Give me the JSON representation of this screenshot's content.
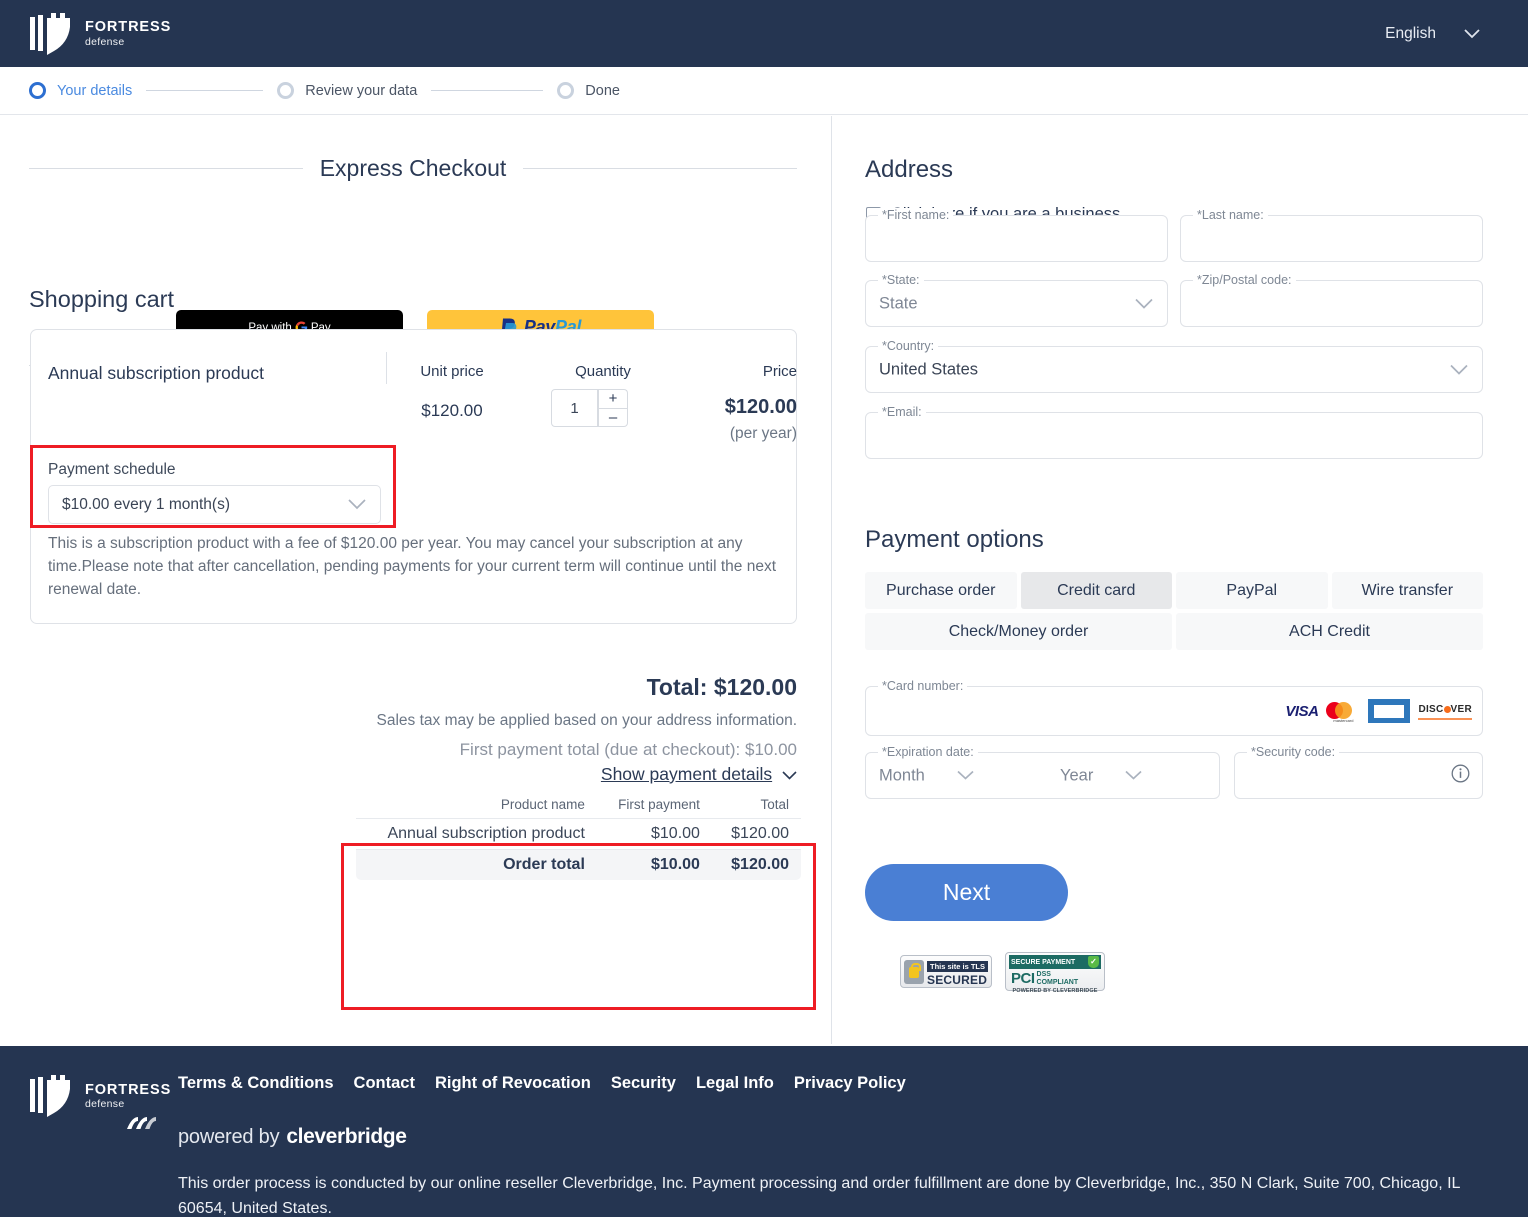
{
  "header": {
    "brand_title": "FORTRESS",
    "brand_sub": "defense",
    "language": "English"
  },
  "stepper": {
    "steps": [
      {
        "label": "Your details",
        "state": "active"
      },
      {
        "label": "Review your data",
        "state": "inactive"
      },
      {
        "label": "Done",
        "state": "inactive"
      }
    ]
  },
  "express": {
    "title": "Express Checkout",
    "gpay_label": "Pay with",
    "gpay_g": "G",
    "gpay_pay": "Pay",
    "paypal_p": "Pay",
    "paypal_pal": "Pal"
  },
  "cart": {
    "title": "Shopping cart",
    "product_name": "Annual subscription product",
    "col_unit_price": "Unit price",
    "col_quantity": "Quantity",
    "col_price": "Price",
    "unit_price": "$120.00",
    "quantity": "1",
    "increment": "+",
    "decrement": "–",
    "price": "$120.00",
    "price_period": "(per year)",
    "schedule_label": "Payment schedule",
    "schedule_value": "$10.00 every 1 month(s)",
    "subscription_note": "This is a subscription product with a fee of $120.00 per year. You may cancel your subscription at any time.Please note that after cancellation, pending payments for your current term will continue until the next renewal date."
  },
  "totals": {
    "total_line": "Total: $120.00",
    "tax_note": "Sales tax may be applied based on your address information.",
    "first_payment_line": "First payment total (due at checkout):  $10.00",
    "show_details": "Show payment details",
    "table": {
      "headers": [
        "Product name",
        "First payment",
        "Total"
      ],
      "rows": [
        {
          "name": "Annual subscription product",
          "first_payment": "$10.00",
          "total": "$120.00"
        }
      ],
      "order_total": {
        "name": "Order total",
        "first_payment": "$10.00",
        "total": "$120.00"
      }
    }
  },
  "address": {
    "title": "Address",
    "business_checkbox_label": "Click here if you are a business.",
    "fields": [
      {
        "label": "*First name:",
        "value": ""
      },
      {
        "label": "*Last name:",
        "value": ""
      },
      {
        "label": "*State:",
        "value": "State"
      },
      {
        "label": "*Zip/Postal code:",
        "value": ""
      },
      {
        "label": "*Country:",
        "value": "United States"
      },
      {
        "label": "*Email:",
        "value": ""
      }
    ]
  },
  "payment": {
    "title": "Payment options",
    "tabs_row1": [
      {
        "label": "Purchase order",
        "selected": false
      },
      {
        "label": "Credit card",
        "selected": true
      },
      {
        "label": "PayPal",
        "selected": false
      },
      {
        "label": "Wire transfer",
        "selected": false
      }
    ],
    "tabs_row2": [
      {
        "label": "Check/Money order",
        "selected": false
      },
      {
        "label": "ACH Credit",
        "selected": false
      }
    ],
    "card_number_label": "*Card number:",
    "card_number_value": "",
    "card_brands": [
      "VISA",
      "mastercard",
      "AMERICAN EXPRESS",
      "DISCOVER"
    ],
    "expiration_label": "*Expiration date:",
    "expiration_month": "Month",
    "expiration_year": "Year",
    "security_label": "*Security code:",
    "security_value": "",
    "next_button": "Next",
    "badges": {
      "tls_top": "This site is TLS",
      "tls_bottom": "SECURED",
      "pci_top": "SECURE PAYMENT",
      "pci_main": "PCI",
      "pci_dss": "DSS",
      "pci_compliant": "COMPLIANT",
      "pci_bottom": "POWERED BY CLEVERBRIDGE"
    }
  },
  "footer": {
    "brand_title": "FORTRESS",
    "brand_sub": "defense",
    "links": [
      "Terms & Conditions",
      "Contact",
      "Right of Revocation",
      "Security",
      "Legal Info",
      "Privacy Policy"
    ],
    "powered_by": "powered by",
    "cleverbridge": "cleverbridge",
    "note": "This order process is conducted by our online reseller Cleverbridge, Inc. Payment processing and order fulfillment are done by Cleverbridge, Inc., 350 N Clark, Suite 700, Chicago, IL 60654, United States."
  },
  "colors": {
    "navy": "#253551",
    "accent_blue": "#4a7fd4",
    "step_active": "#4a8ae0",
    "highlight_red": "#ee1c24",
    "paypal_yellow": "#ffc43a"
  }
}
